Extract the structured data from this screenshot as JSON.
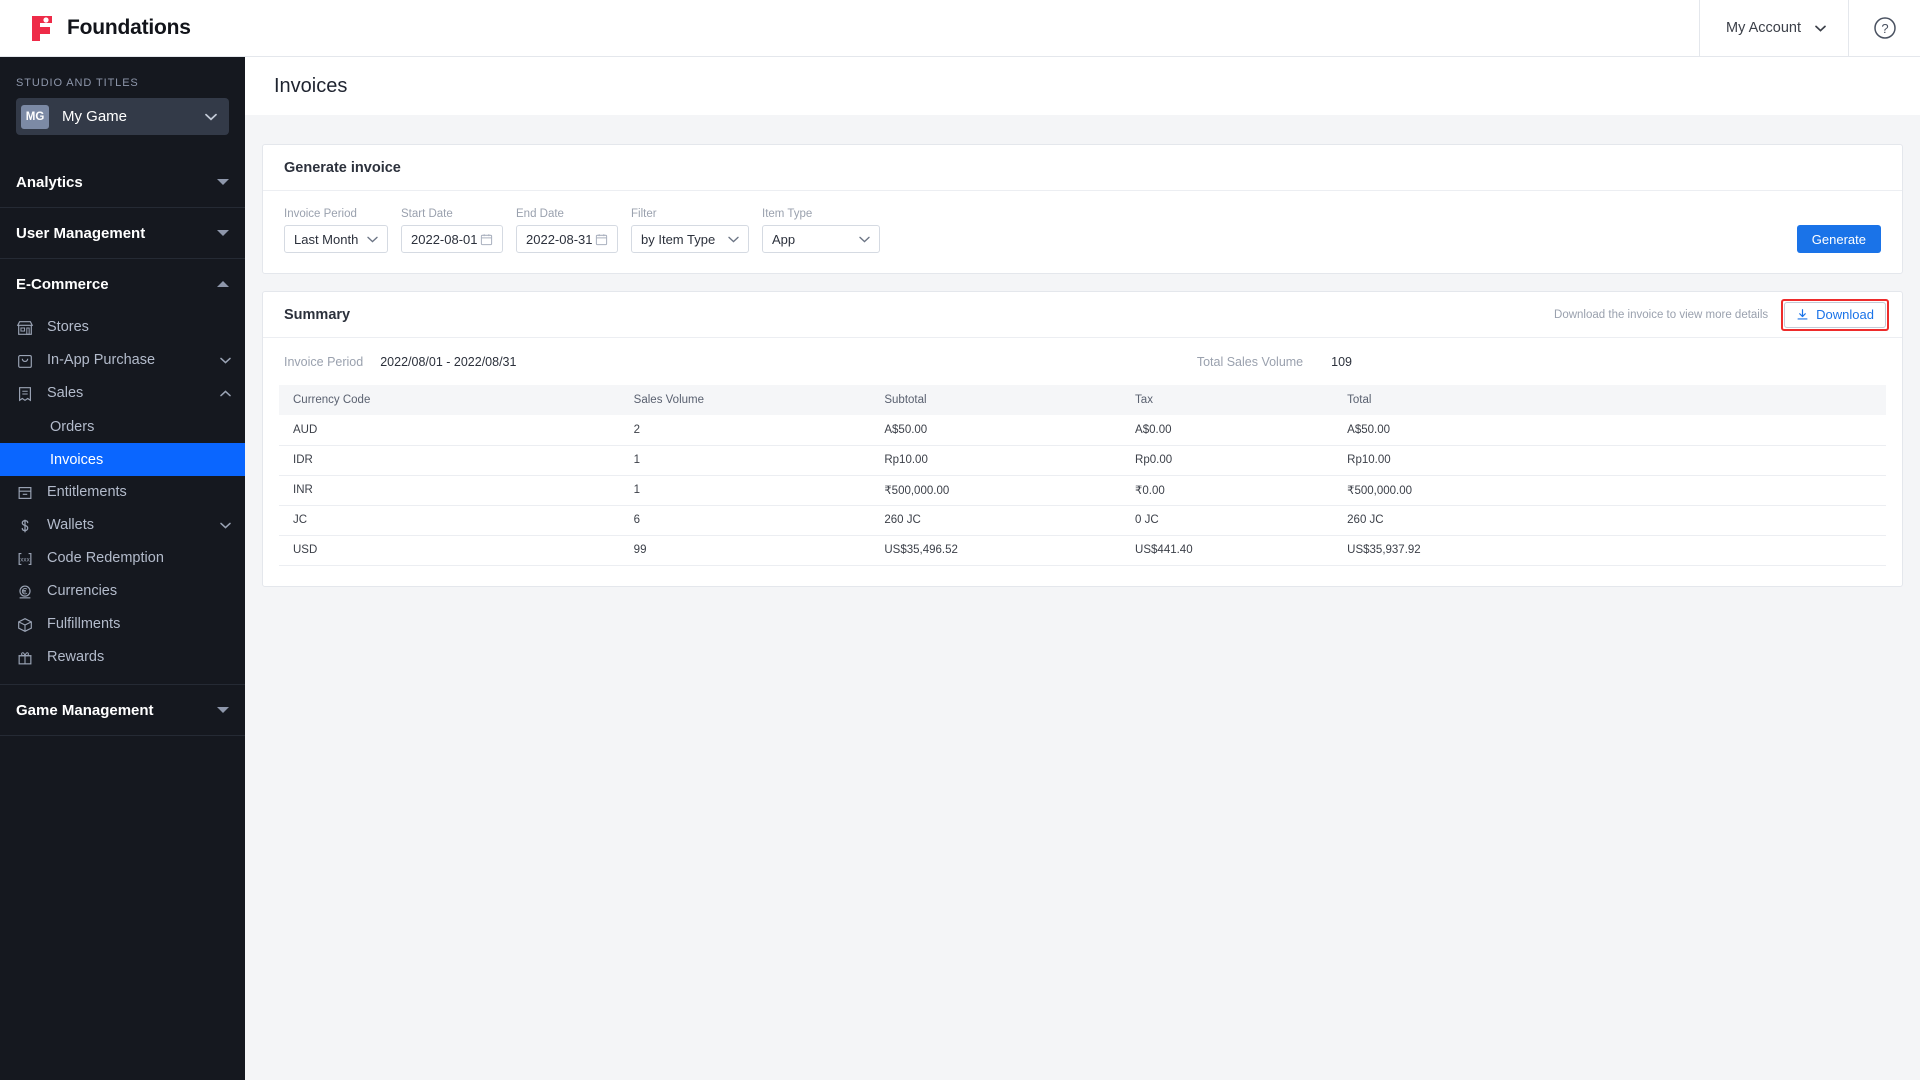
{
  "topbar": {
    "brand": "Foundations",
    "account_label": "My Account",
    "help_icon": "question-circle-icon",
    "chevron_icon": "chevron-down-icon"
  },
  "sidebar": {
    "studio_label": "STUDIO AND TITLES",
    "game": {
      "badge": "MG",
      "name": "My Game"
    },
    "groups": [
      {
        "label": "Analytics",
        "state": "collapsed"
      },
      {
        "label": "User Management",
        "state": "collapsed"
      },
      {
        "label": "E-Commerce",
        "state": "expanded"
      },
      {
        "label": "Game Management",
        "state": "collapsed"
      }
    ],
    "ecommerce_items": [
      {
        "label": "Stores",
        "icon": "store-icon",
        "expandable": false
      },
      {
        "label": "In-App Purchase",
        "icon": "bag-icon",
        "expandable": true
      },
      {
        "label": "Sales",
        "icon": "receipt-icon",
        "expandable": true,
        "expanded": true,
        "children": [
          {
            "label": "Orders",
            "active": false
          },
          {
            "label": "Invoices",
            "active": true
          }
        ]
      },
      {
        "label": "Entitlements",
        "icon": "archive-icon",
        "expandable": false
      },
      {
        "label": "Wallets",
        "icon": "dollar-icon",
        "expandable": true
      },
      {
        "label": "Code Redemption",
        "icon": "code-icon",
        "expandable": false
      },
      {
        "label": "Currencies",
        "icon": "euro-coin-icon",
        "expandable": false
      },
      {
        "label": "Fulfillments",
        "icon": "box-icon",
        "expandable": false
      },
      {
        "label": "Rewards",
        "icon": "gift-icon",
        "expandable": false
      }
    ]
  },
  "page": {
    "title": "Invoices"
  },
  "generate": {
    "card_title": "Generate invoice",
    "fields": {
      "invoice_period": {
        "label": "Invoice Period",
        "value": "Last Month"
      },
      "start_date": {
        "label": "Start Date",
        "value": "2022-08-01",
        "icon": "calendar-icon"
      },
      "end_date": {
        "label": "End Date",
        "value": "2022-08-31",
        "icon": "calendar-icon"
      },
      "filter": {
        "label": "Filter",
        "value": "by Item Type"
      },
      "item_type": {
        "label": "Item Type",
        "value": "App"
      }
    },
    "generate_button": "Generate"
  },
  "summary": {
    "card_title": "Summary",
    "download_hint": "Download the invoice to view more details",
    "download_button": "Download",
    "download_icon": "download-icon",
    "highlight_color": "#ee2b2b",
    "meta": {
      "invoice_period_label": "Invoice Period",
      "invoice_period_value": "2022/08/01 - 2022/08/31",
      "total_volume_label": "Total Sales Volume",
      "total_volume_value": "109"
    },
    "table": {
      "headers": [
        "Currency Code",
        "Sales Volume",
        "Subtotal",
        "Tax",
        "Total"
      ],
      "rows": [
        {
          "currency": "AUD",
          "volume": "2",
          "subtotal": "A$50.00",
          "tax": "A$0.00",
          "total": "A$50.00"
        },
        {
          "currency": "IDR",
          "volume": "1",
          "subtotal": "Rp10.00",
          "tax": "Rp0.00",
          "total": "Rp10.00"
        },
        {
          "currency": "INR",
          "volume": "1",
          "subtotal": "₹500,000.00",
          "tax": "₹0.00",
          "total": "₹500,000.00"
        },
        {
          "currency": "JC",
          "volume": "6",
          "subtotal": "260 JC",
          "tax": "0 JC",
          "total": "260 JC"
        },
        {
          "currency": "USD",
          "volume": "99",
          "subtotal": "US$35,496.52",
          "tax": "US$441.40",
          "total": "US$35,937.92"
        }
      ]
    }
  }
}
